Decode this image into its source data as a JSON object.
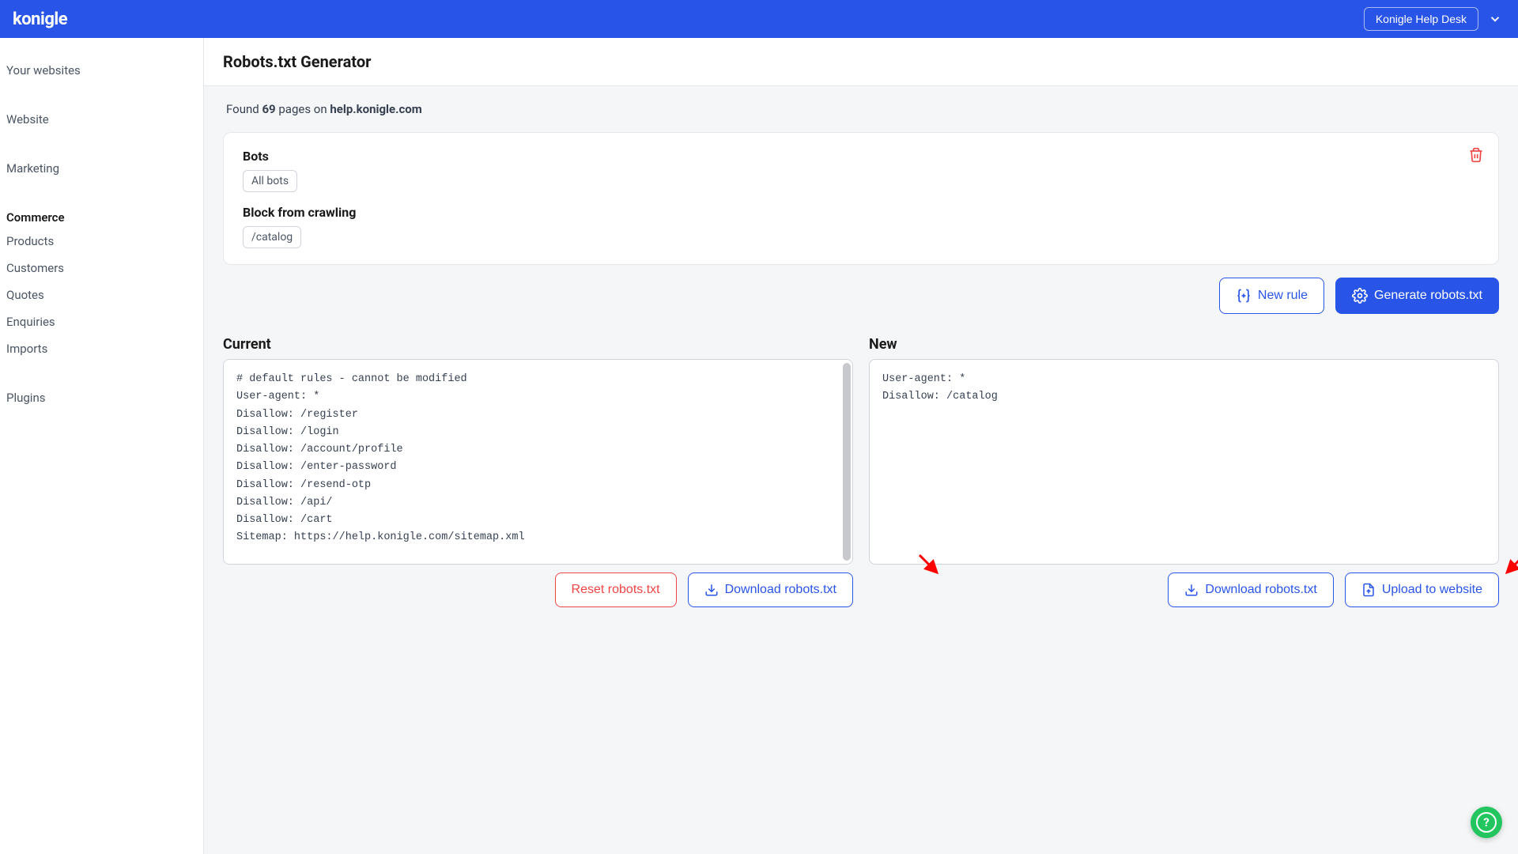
{
  "topbar": {
    "logo_text": "konigle",
    "helpdesk_label": "Konigle Help Desk"
  },
  "sidebar": {
    "your_websites": "Your websites",
    "website": "Website",
    "marketing": "Marketing",
    "commerce_header": "Commerce",
    "products": "Products",
    "customers": "Customers",
    "quotes": "Quotes",
    "enquiries": "Enquiries",
    "imports": "Imports",
    "plugins": "Plugins"
  },
  "page": {
    "title": "Robots.txt Generator",
    "found_prefix": "Found ",
    "found_count": "69",
    "found_mid": " pages on ",
    "found_domain": "help.konigle.com"
  },
  "rule_card": {
    "bots_label": "Bots",
    "bots_chip": "All bots",
    "block_label": "Block from crawling",
    "block_chip": "/catalog"
  },
  "actions": {
    "new_rule": "New rule",
    "generate": "Generate robots.txt",
    "reset": "Reset robots.txt",
    "download": "Download robots.txt",
    "upload": "Upload to website"
  },
  "panels": {
    "current_title": "Current",
    "new_title": "New",
    "current_content": "# default rules - cannot be modified\nUser-agent: *\nDisallow: /register\nDisallow: /login\nDisallow: /account/profile\nDisallow: /enter-password\nDisallow: /resend-otp\nDisallow: /api/\nDisallow: /cart\nSitemap: https://help.konigle.com/sitemap.xml\n\nUser-agent: PetalBot\nDisallow: /\n# end of default rules",
    "new_content": "User-agent: *\nDisallow: /catalog"
  },
  "colors": {
    "primary": "#2954e8",
    "danger": "#ef4444",
    "success": "#22c55e"
  }
}
